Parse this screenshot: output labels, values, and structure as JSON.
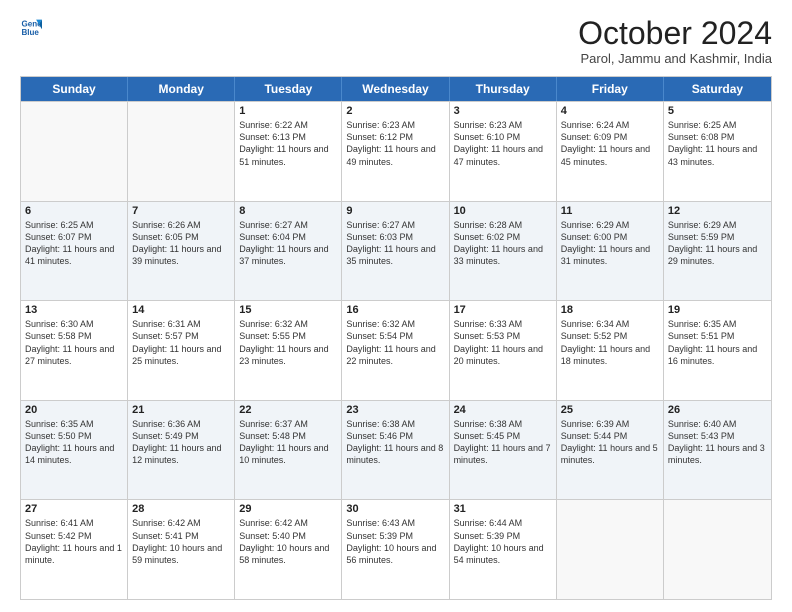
{
  "logo": {
    "line1": "General",
    "line2": "Blue"
  },
  "header": {
    "title": "October 2024",
    "subtitle": "Parol, Jammu and Kashmir, India"
  },
  "days": [
    "Sunday",
    "Monday",
    "Tuesday",
    "Wednesday",
    "Thursday",
    "Friday",
    "Saturday"
  ],
  "weeks": [
    [
      {
        "day": "",
        "sunrise": "",
        "sunset": "",
        "daylight": ""
      },
      {
        "day": "",
        "sunrise": "",
        "sunset": "",
        "daylight": ""
      },
      {
        "day": "1",
        "sunrise": "Sunrise: 6:22 AM",
        "sunset": "Sunset: 6:13 PM",
        "daylight": "Daylight: 11 hours and 51 minutes."
      },
      {
        "day": "2",
        "sunrise": "Sunrise: 6:23 AM",
        "sunset": "Sunset: 6:12 PM",
        "daylight": "Daylight: 11 hours and 49 minutes."
      },
      {
        "day": "3",
        "sunrise": "Sunrise: 6:23 AM",
        "sunset": "Sunset: 6:10 PM",
        "daylight": "Daylight: 11 hours and 47 minutes."
      },
      {
        "day": "4",
        "sunrise": "Sunrise: 6:24 AM",
        "sunset": "Sunset: 6:09 PM",
        "daylight": "Daylight: 11 hours and 45 minutes."
      },
      {
        "day": "5",
        "sunrise": "Sunrise: 6:25 AM",
        "sunset": "Sunset: 6:08 PM",
        "daylight": "Daylight: 11 hours and 43 minutes."
      }
    ],
    [
      {
        "day": "6",
        "sunrise": "Sunrise: 6:25 AM",
        "sunset": "Sunset: 6:07 PM",
        "daylight": "Daylight: 11 hours and 41 minutes."
      },
      {
        "day": "7",
        "sunrise": "Sunrise: 6:26 AM",
        "sunset": "Sunset: 6:05 PM",
        "daylight": "Daylight: 11 hours and 39 minutes."
      },
      {
        "day": "8",
        "sunrise": "Sunrise: 6:27 AM",
        "sunset": "Sunset: 6:04 PM",
        "daylight": "Daylight: 11 hours and 37 minutes."
      },
      {
        "day": "9",
        "sunrise": "Sunrise: 6:27 AM",
        "sunset": "Sunset: 6:03 PM",
        "daylight": "Daylight: 11 hours and 35 minutes."
      },
      {
        "day": "10",
        "sunrise": "Sunrise: 6:28 AM",
        "sunset": "Sunset: 6:02 PM",
        "daylight": "Daylight: 11 hours and 33 minutes."
      },
      {
        "day": "11",
        "sunrise": "Sunrise: 6:29 AM",
        "sunset": "Sunset: 6:00 PM",
        "daylight": "Daylight: 11 hours and 31 minutes."
      },
      {
        "day": "12",
        "sunrise": "Sunrise: 6:29 AM",
        "sunset": "Sunset: 5:59 PM",
        "daylight": "Daylight: 11 hours and 29 minutes."
      }
    ],
    [
      {
        "day": "13",
        "sunrise": "Sunrise: 6:30 AM",
        "sunset": "Sunset: 5:58 PM",
        "daylight": "Daylight: 11 hours and 27 minutes."
      },
      {
        "day": "14",
        "sunrise": "Sunrise: 6:31 AM",
        "sunset": "Sunset: 5:57 PM",
        "daylight": "Daylight: 11 hours and 25 minutes."
      },
      {
        "day": "15",
        "sunrise": "Sunrise: 6:32 AM",
        "sunset": "Sunset: 5:55 PM",
        "daylight": "Daylight: 11 hours and 23 minutes."
      },
      {
        "day": "16",
        "sunrise": "Sunrise: 6:32 AM",
        "sunset": "Sunset: 5:54 PM",
        "daylight": "Daylight: 11 hours and 22 minutes."
      },
      {
        "day": "17",
        "sunrise": "Sunrise: 6:33 AM",
        "sunset": "Sunset: 5:53 PM",
        "daylight": "Daylight: 11 hours and 20 minutes."
      },
      {
        "day": "18",
        "sunrise": "Sunrise: 6:34 AM",
        "sunset": "Sunset: 5:52 PM",
        "daylight": "Daylight: 11 hours and 18 minutes."
      },
      {
        "day": "19",
        "sunrise": "Sunrise: 6:35 AM",
        "sunset": "Sunset: 5:51 PM",
        "daylight": "Daylight: 11 hours and 16 minutes."
      }
    ],
    [
      {
        "day": "20",
        "sunrise": "Sunrise: 6:35 AM",
        "sunset": "Sunset: 5:50 PM",
        "daylight": "Daylight: 11 hours and 14 minutes."
      },
      {
        "day": "21",
        "sunrise": "Sunrise: 6:36 AM",
        "sunset": "Sunset: 5:49 PM",
        "daylight": "Daylight: 11 hours and 12 minutes."
      },
      {
        "day": "22",
        "sunrise": "Sunrise: 6:37 AM",
        "sunset": "Sunset: 5:48 PM",
        "daylight": "Daylight: 11 hours and 10 minutes."
      },
      {
        "day": "23",
        "sunrise": "Sunrise: 6:38 AM",
        "sunset": "Sunset: 5:46 PM",
        "daylight": "Daylight: 11 hours and 8 minutes."
      },
      {
        "day": "24",
        "sunrise": "Sunrise: 6:38 AM",
        "sunset": "Sunset: 5:45 PM",
        "daylight": "Daylight: 11 hours and 7 minutes."
      },
      {
        "day": "25",
        "sunrise": "Sunrise: 6:39 AM",
        "sunset": "Sunset: 5:44 PM",
        "daylight": "Daylight: 11 hours and 5 minutes."
      },
      {
        "day": "26",
        "sunrise": "Sunrise: 6:40 AM",
        "sunset": "Sunset: 5:43 PM",
        "daylight": "Daylight: 11 hours and 3 minutes."
      }
    ],
    [
      {
        "day": "27",
        "sunrise": "Sunrise: 6:41 AM",
        "sunset": "Sunset: 5:42 PM",
        "daylight": "Daylight: 11 hours and 1 minute."
      },
      {
        "day": "28",
        "sunrise": "Sunrise: 6:42 AM",
        "sunset": "Sunset: 5:41 PM",
        "daylight": "Daylight: 10 hours and 59 minutes."
      },
      {
        "day": "29",
        "sunrise": "Sunrise: 6:42 AM",
        "sunset": "Sunset: 5:40 PM",
        "daylight": "Daylight: 10 hours and 58 minutes."
      },
      {
        "day": "30",
        "sunrise": "Sunrise: 6:43 AM",
        "sunset": "Sunset: 5:39 PM",
        "daylight": "Daylight: 10 hours and 56 minutes."
      },
      {
        "day": "31",
        "sunrise": "Sunrise: 6:44 AM",
        "sunset": "Sunset: 5:39 PM",
        "daylight": "Daylight: 10 hours and 54 minutes."
      },
      {
        "day": "",
        "sunrise": "",
        "sunset": "",
        "daylight": ""
      },
      {
        "day": "",
        "sunrise": "",
        "sunset": "",
        "daylight": ""
      }
    ]
  ]
}
